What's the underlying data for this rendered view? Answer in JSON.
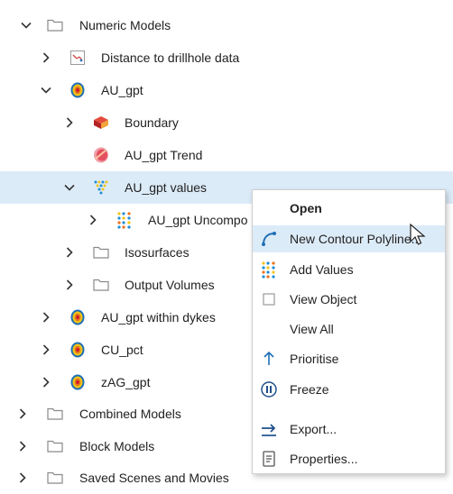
{
  "tree": {
    "items": [
      {
        "label": "Numeric Models"
      },
      {
        "label": "Distance to drillhole data"
      },
      {
        "label": "AU_gpt"
      },
      {
        "label": "Boundary"
      },
      {
        "label": "AU_gpt Trend"
      },
      {
        "label": "AU_gpt values"
      },
      {
        "label": "AU_gpt Uncompo"
      },
      {
        "label": "Isosurfaces"
      },
      {
        "label": "Output Volumes"
      },
      {
        "label": "AU_gpt within dykes"
      },
      {
        "label": "CU_pct"
      },
      {
        "label": "zAG_gpt"
      },
      {
        "label": "Combined Models"
      },
      {
        "label": "Block Models"
      },
      {
        "label": "Saved Scenes and Movies"
      }
    ]
  },
  "context_menu": {
    "items": [
      {
        "label": "Open"
      },
      {
        "label": "New Contour Polyline..."
      },
      {
        "label": "Add Values"
      },
      {
        "label": "View Object"
      },
      {
        "label": "View All"
      },
      {
        "label": "Prioritise"
      },
      {
        "label": "Freeze"
      },
      {
        "label": "Export..."
      },
      {
        "label": "Properties..."
      }
    ]
  },
  "colors": {
    "selection": "#dcebf8",
    "chevron": "#333333",
    "folder_outline": "#8a8a8a",
    "accent_blue": "#1f6fb5"
  }
}
